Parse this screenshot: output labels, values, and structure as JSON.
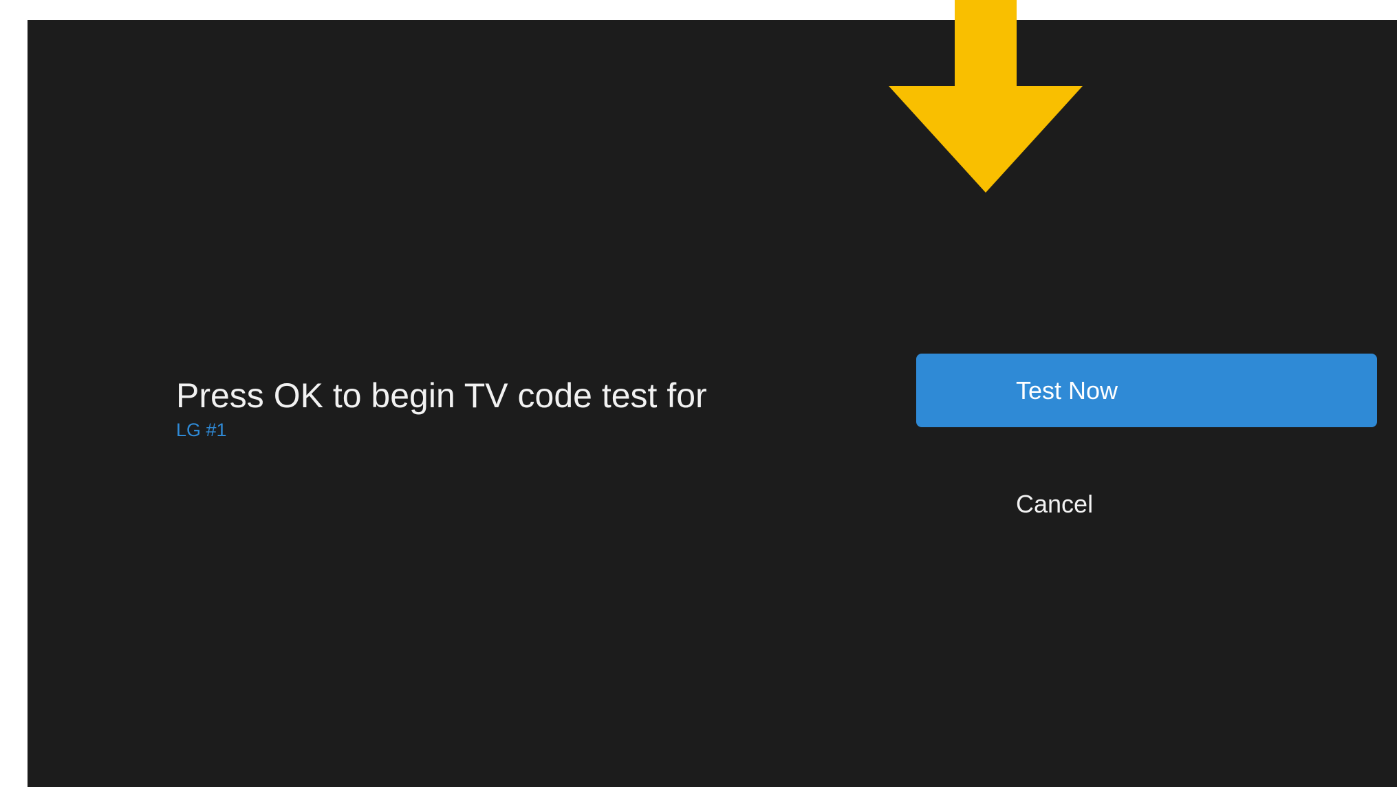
{
  "prompt": {
    "title": "Press OK to begin TV code test for",
    "device": "LG #1"
  },
  "actions": {
    "primary_label": "Test Now",
    "cancel_label": "Cancel"
  },
  "icons": {
    "pointer": "arrow-down-icon"
  },
  "colors": {
    "screen_bg": "#1c1c1c",
    "accent": "#2f8ad6",
    "device_text": "#2f8ad6",
    "arrow": "#f9bf00"
  }
}
